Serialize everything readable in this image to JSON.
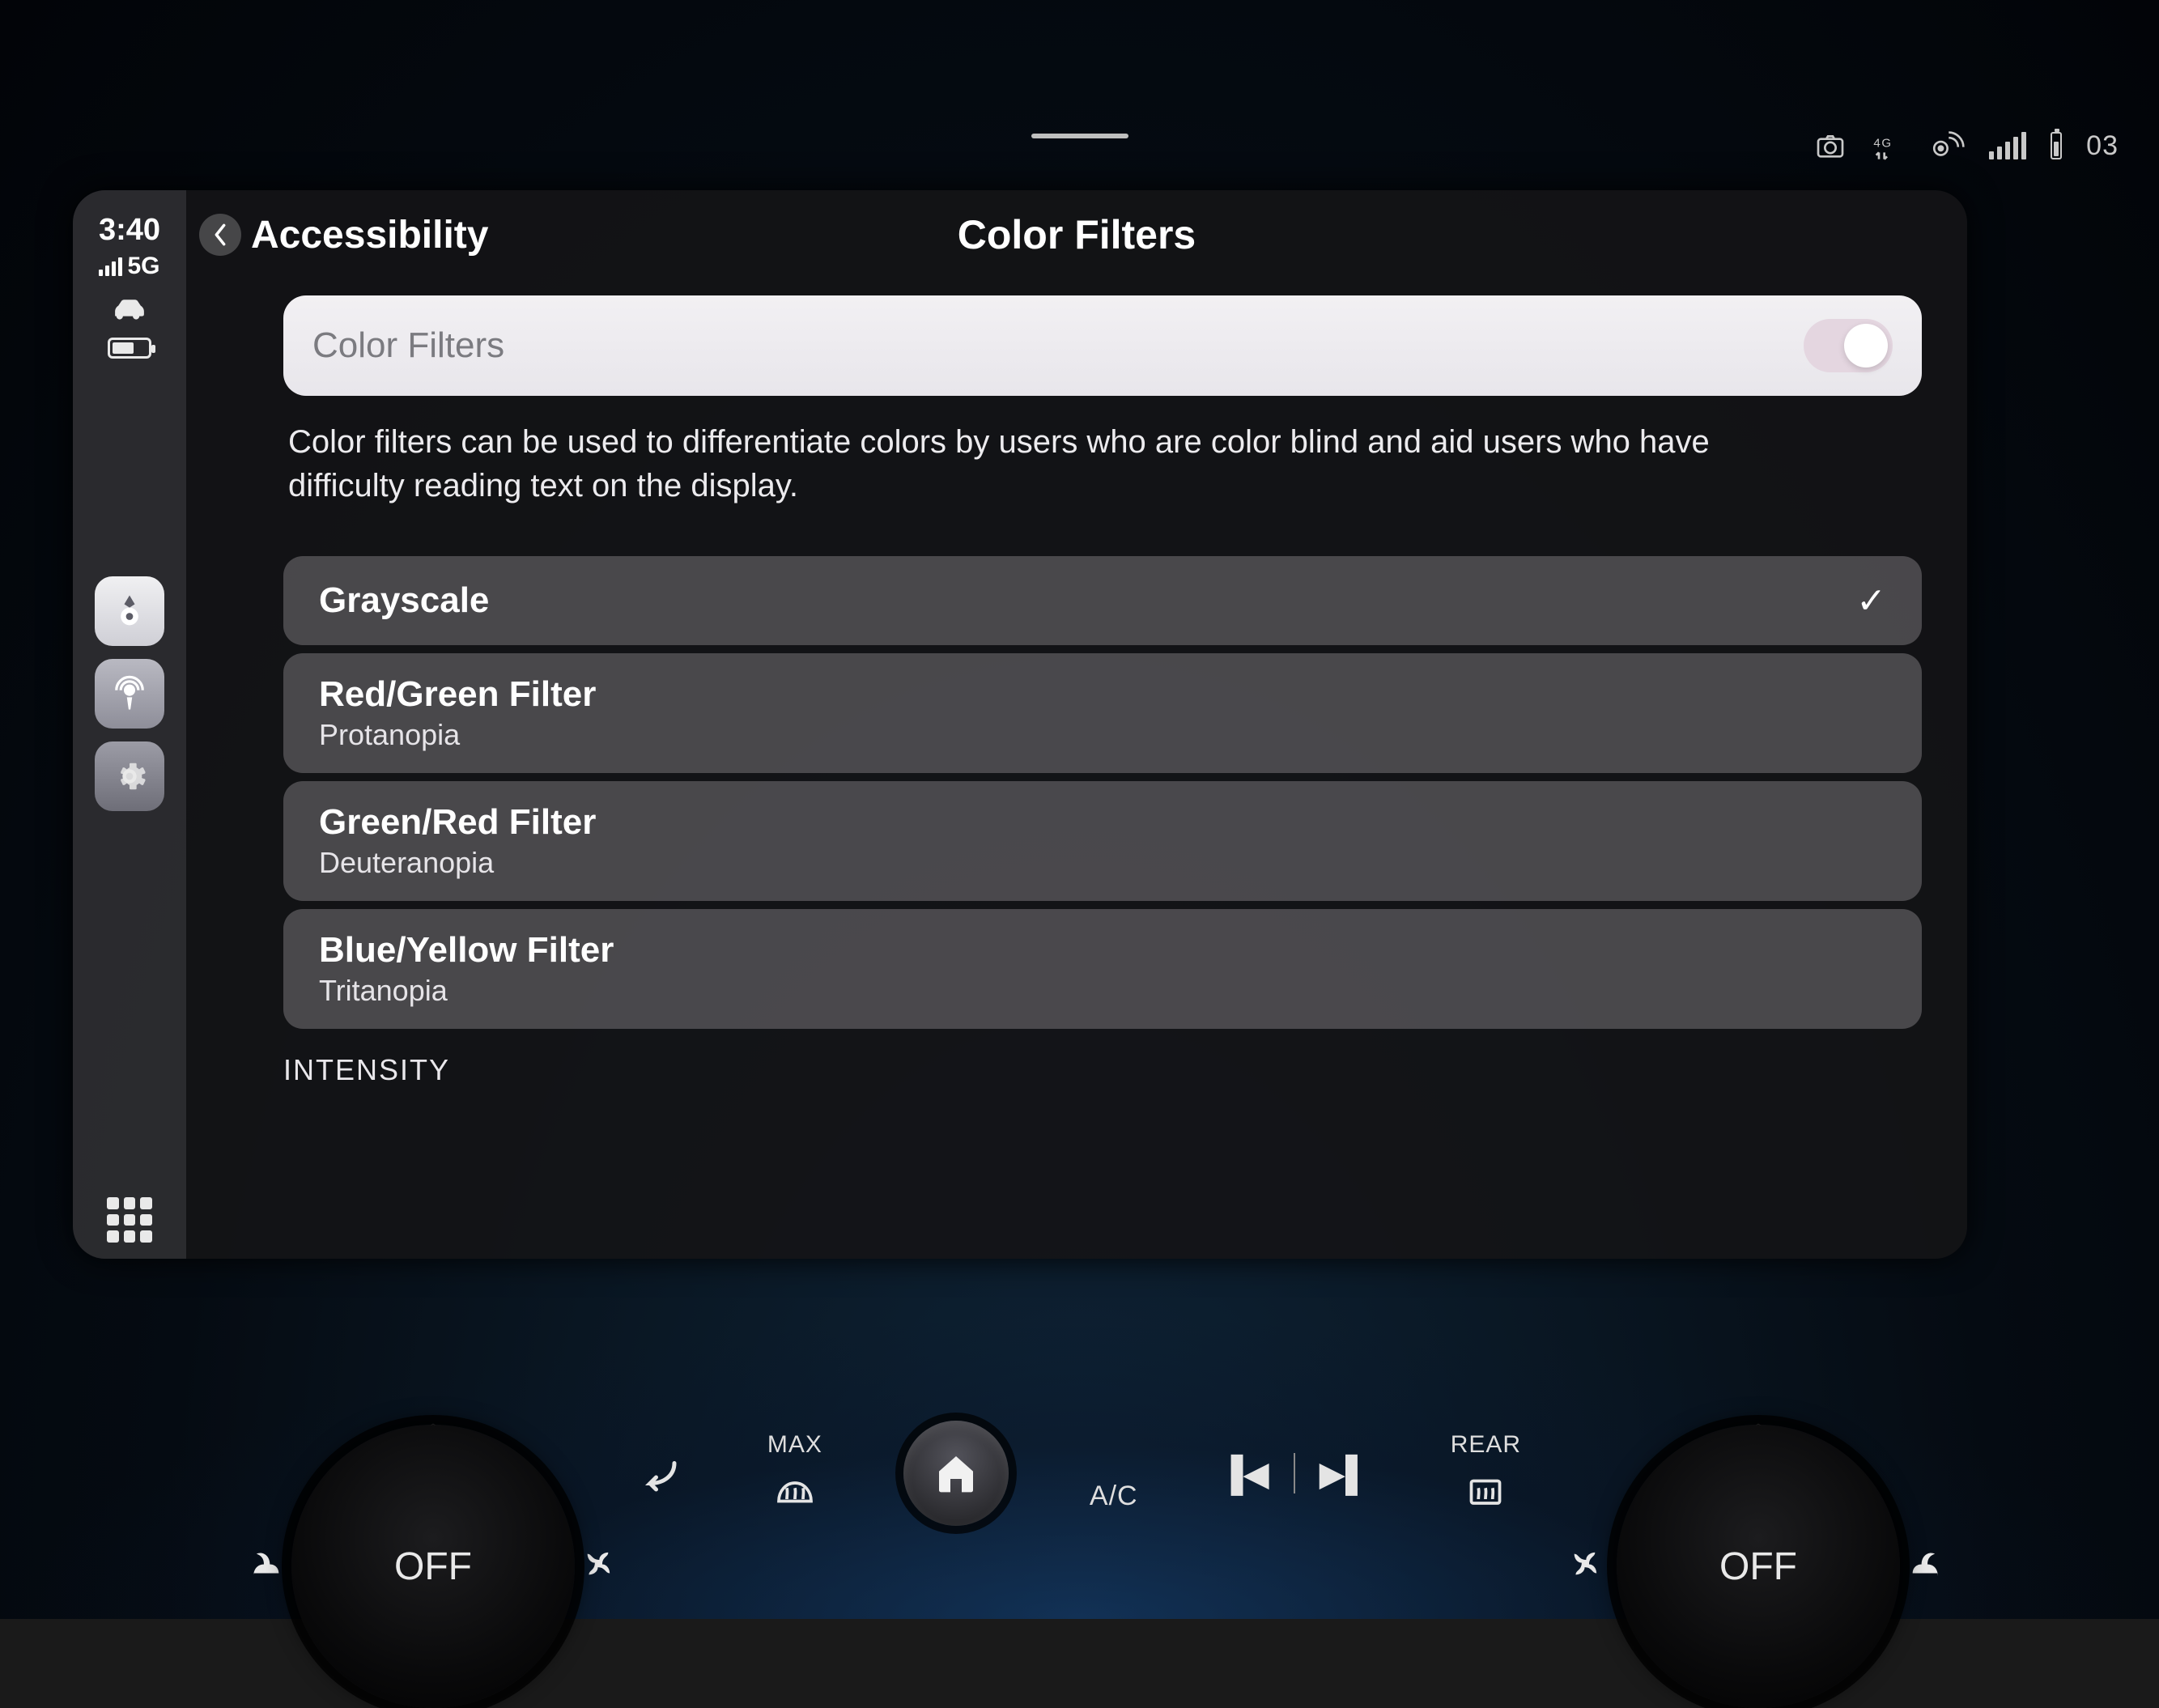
{
  "vehicle_status": {
    "time": "03",
    "icons": [
      "camera-icon",
      "4g-traffic-icon",
      "gps-icon",
      "signal-icon",
      "battery-icon"
    ]
  },
  "sidebar": {
    "clock": "3:40",
    "network": "5G",
    "apps": [
      "maps",
      "podcasts",
      "settings"
    ]
  },
  "header": {
    "back_label": "Accessibility",
    "title": "Color Filters"
  },
  "toggle": {
    "label": "Color Filters",
    "on": true
  },
  "description": "Color filters can be used to differentiate colors by users who are color blind and aid users who have difficulty reading text on the display.",
  "options": [
    {
      "title": "Grayscale",
      "subtitle": "",
      "selected": true
    },
    {
      "title": "Red/Green Filter",
      "subtitle": "Protanopia",
      "selected": false
    },
    {
      "title": "Green/Red Filter",
      "subtitle": "Deuteranopia",
      "selected": false
    },
    {
      "title": "Blue/Yellow Filter",
      "subtitle": "Tritanopia",
      "selected": false
    }
  ],
  "section_intensity": "INTENSITY",
  "hvac": {
    "left_dial": "OFF",
    "right_dial": "OFF",
    "defrost_max_label": "MAX",
    "ac_label": "A/C",
    "rear_label": "REAR"
  }
}
